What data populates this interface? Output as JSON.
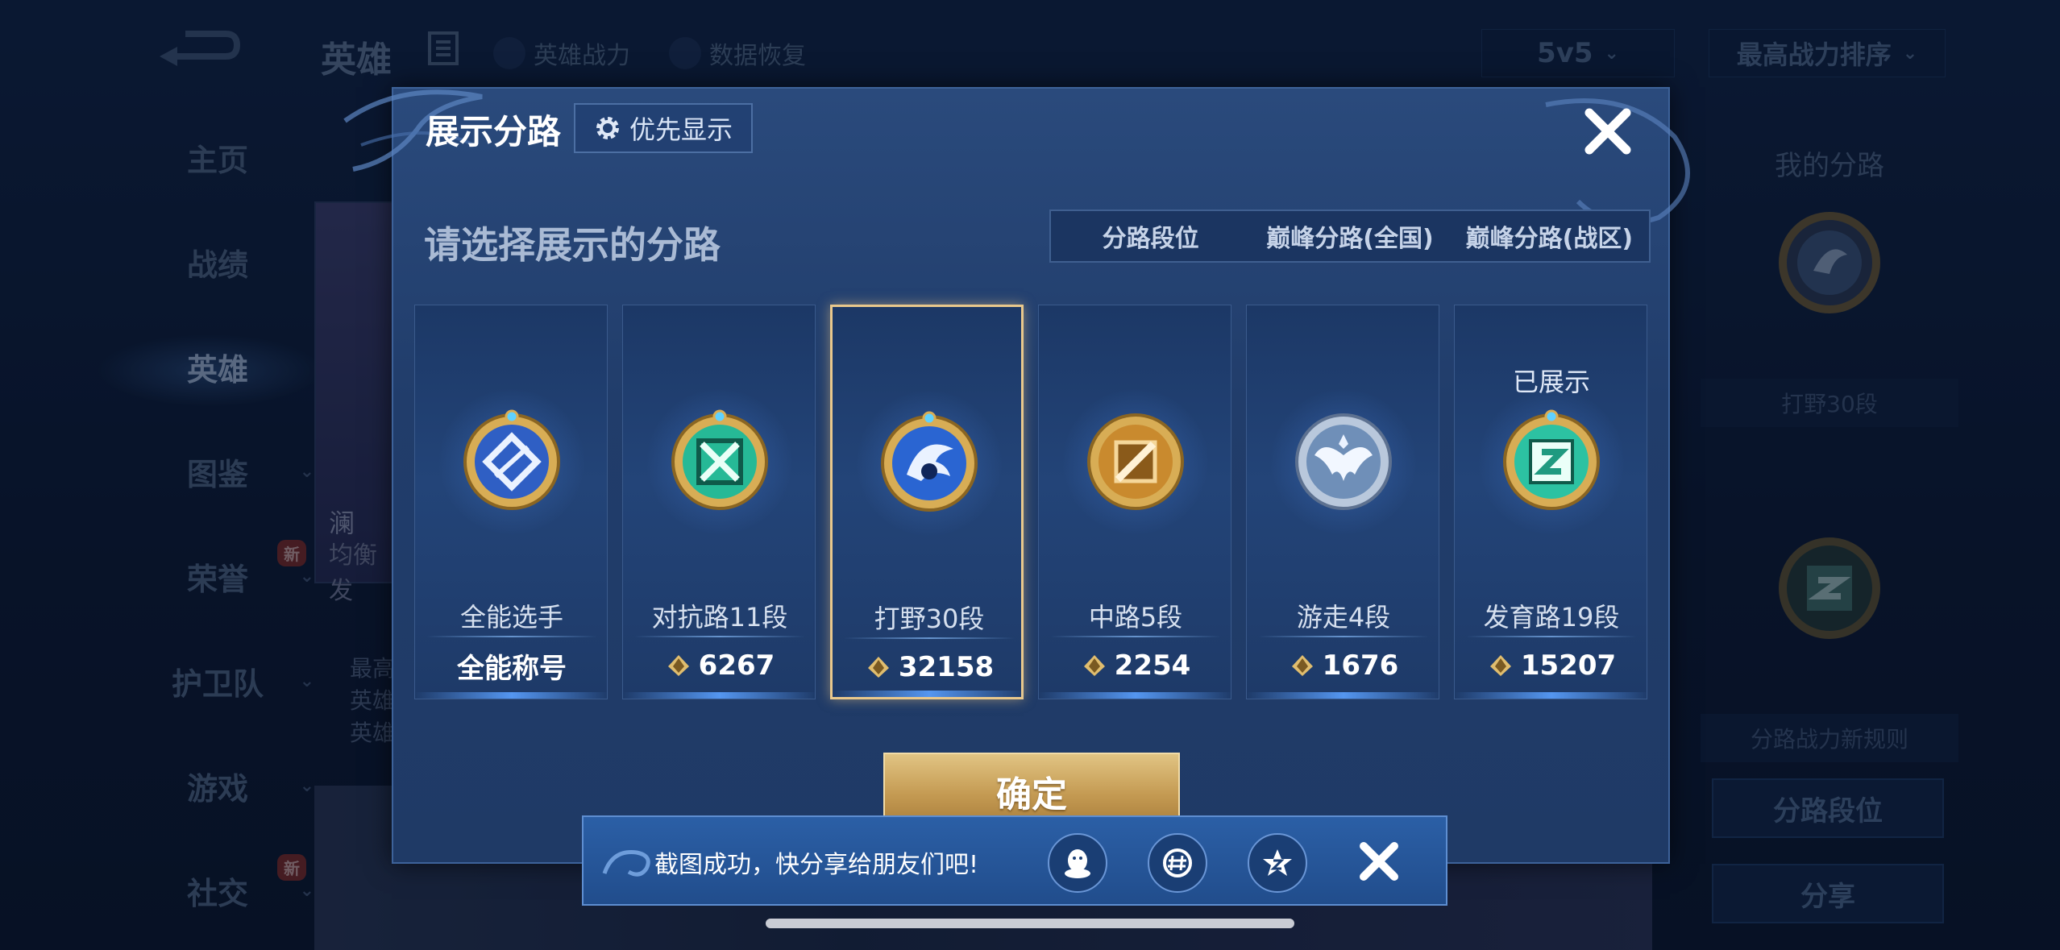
{
  "background": {
    "page_title": "英雄",
    "top_links": [
      "英雄战力",
      "数据恢复"
    ],
    "mode_select": "5v5",
    "sort_select": "最高战力排序",
    "sidebar": [
      {
        "label": "主页"
      },
      {
        "label": "战绩"
      },
      {
        "label": "英雄",
        "active": true
      },
      {
        "label": "图鉴"
      },
      {
        "label": "荣誉",
        "badge": "新"
      },
      {
        "label": "护卫队"
      },
      {
        "label": "游戏"
      },
      {
        "label": "社交",
        "badge": "新"
      }
    ],
    "hero_card": {
      "name": "澜",
      "subtitle": "均衡发"
    },
    "left_list": [
      "最高",
      "英雄",
      "英雄"
    ],
    "right_panel": {
      "title": "我的分路",
      "label": "打野30段",
      "rule_link": "分路战力新规则",
      "button_position": "分路段位",
      "button_share": "分享"
    }
  },
  "modal": {
    "title": "展示分路",
    "priority_button": "优先显示",
    "subtitle": "请选择展示的分路",
    "tabs": [
      {
        "label": "分路段位",
        "active": true
      },
      {
        "label": "巅峰分路(全国)",
        "active": false
      },
      {
        "label": "巅峰分路(战区)",
        "active": false
      }
    ],
    "cards": [
      {
        "name": "全能选手",
        "value": "全能称号",
        "emblem": "allround-emblem-icon",
        "color": "#3a6fd8",
        "selected": false,
        "shown": "",
        "has_power_icon": false
      },
      {
        "name": "对抗路11段",
        "value": "6267",
        "emblem": "clash-lane-emblem-icon",
        "color": "#2fc3a0",
        "selected": false,
        "shown": "",
        "has_power_icon": true
      },
      {
        "name": "打野30段",
        "value": "32158",
        "emblem": "jungle-dragon-emblem-icon",
        "color": "#2f6fd8",
        "selected": true,
        "shown": "",
        "has_power_icon": true
      },
      {
        "name": "中路5段",
        "value": "2254",
        "emblem": "mid-lane-emblem-icon",
        "color": "#d99a3a",
        "selected": false,
        "shown": "",
        "has_power_icon": true
      },
      {
        "name": "游走4段",
        "value": "1676",
        "emblem": "roam-wings-emblem-icon",
        "color": "#8fb3e0",
        "selected": false,
        "shown": "",
        "has_power_icon": true
      },
      {
        "name": "发育路19段",
        "value": "15207",
        "emblem": "farm-lane-emblem-icon",
        "color": "#2fc3a0",
        "selected": false,
        "shown": "已展示",
        "has_power_icon": true
      }
    ],
    "confirm_button": "确定"
  },
  "toast": {
    "message": "截图成功，快分享给朋友们吧!",
    "share_targets": [
      "qq-icon",
      "moments-icon",
      "qzone-icon"
    ]
  }
}
